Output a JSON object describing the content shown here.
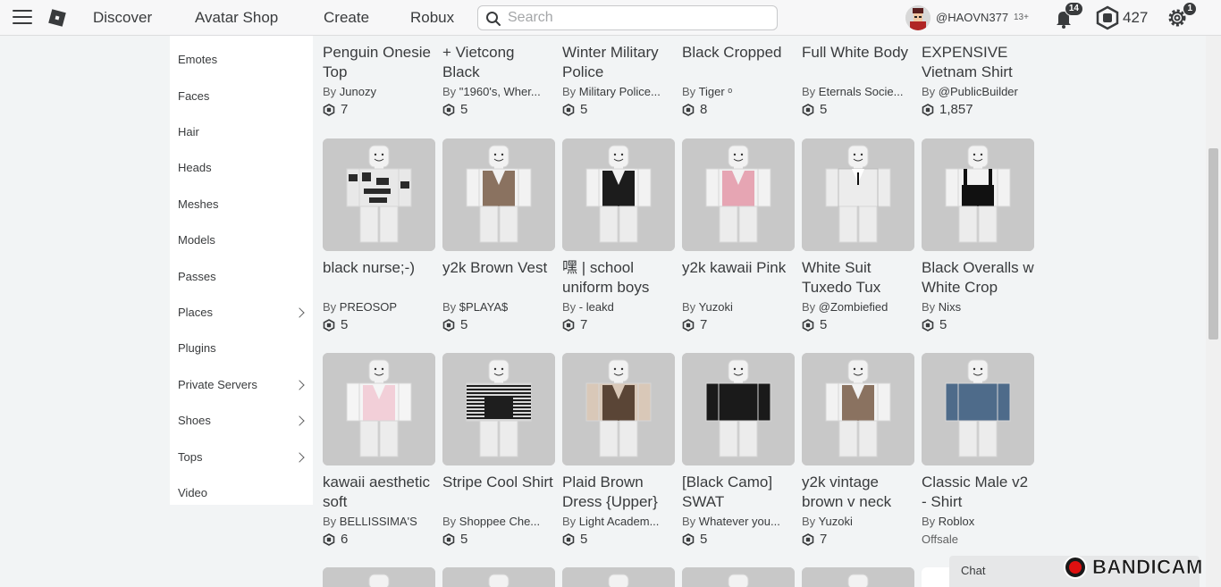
{
  "header": {
    "nav": [
      "Discover",
      "Avatar Shop",
      "Create",
      "Robux"
    ],
    "search_placeholder": "Search",
    "username": "@HAOVN377",
    "age": "13+",
    "notifications": "14",
    "robux": "427",
    "settings_badge": "1"
  },
  "sidebar": {
    "items": [
      {
        "label": "Emotes",
        "chevron": false
      },
      {
        "label": "Faces",
        "chevron": false
      },
      {
        "label": "Hair",
        "chevron": false
      },
      {
        "label": "Heads",
        "chevron": false
      },
      {
        "label": "Meshes",
        "chevron": false
      },
      {
        "label": "Models",
        "chevron": false
      },
      {
        "label": "Passes",
        "chevron": false
      },
      {
        "label": "Places",
        "chevron": true
      },
      {
        "label": "Plugins",
        "chevron": false
      },
      {
        "label": "Private Servers",
        "chevron": true
      },
      {
        "label": "Shoes",
        "chevron": true
      },
      {
        "label": "Tops",
        "chevron": true
      },
      {
        "label": "Video",
        "chevron": false
      }
    ]
  },
  "rows": [
    [
      {
        "name": "Penguin Onesie Top",
        "creator": "Junozy",
        "price": "7"
      },
      {
        "name": "+ Vietcong Black",
        "creator": "\"1960's, Wher...",
        "price": "5"
      },
      {
        "name": "Winter Military Police",
        "creator": "Military Police...",
        "price": "5"
      },
      {
        "name": "Black Cropped",
        "creator": "Tiger ᵒ",
        "price": "8"
      },
      {
        "name": "Full White Body",
        "creator": "Eternals Socie...",
        "price": "5"
      },
      {
        "name": "EXPENSIVE Vietnam Shirt",
        "creator": "@PublicBuilder",
        "price": "1,857"
      }
    ],
    [
      {
        "name": "black nurse;-)",
        "creator": "PREOSOP",
        "price": "5",
        "shirt": "pattern",
        "c1": "#2a2a2a",
        "c2": "#e8e8e8"
      },
      {
        "name": "y2k Brown Vest",
        "creator": "$PLAYA$",
        "price": "5",
        "shirt": "vest",
        "c1": "#8a7260",
        "c2": "#f2f2f2"
      },
      {
        "name": "嘿 | school uniform boys",
        "creator": "- leakd",
        "price": "7",
        "shirt": "vest",
        "c1": "#1c1c1c",
        "c2": "#f2f2f2"
      },
      {
        "name": "y2k kawaii Pink",
        "creator": "Yuzoki",
        "price": "7",
        "shirt": "vest",
        "c1": "#e6a5b3",
        "c2": "#f2f2f2"
      },
      {
        "name": "White Suit Tuxedo Tux",
        "creator": "@Zombiefied",
        "price": "5",
        "shirt": "suit",
        "c1": "#ececec",
        "c2": "#ececec"
      },
      {
        "name": "Black Overalls w White Crop",
        "creator": "Nixs",
        "price": "5",
        "shirt": "overall",
        "c1": "#111111",
        "c2": "#f2f2f2"
      }
    ],
    [
      {
        "name": "kawaii aesthetic soft",
        "creator": "BELLISSIMA'S",
        "price": "6",
        "shirt": "vest",
        "c1": "#f2cfd8",
        "c2": "#f5f5f5"
      },
      {
        "name": "Stripe Cool Shirt",
        "creator": "Shoppee Che...",
        "price": "5",
        "shirt": "stripe",
        "c1": "#1e1e1e",
        "c2": "#d8d8d8"
      },
      {
        "name": "Plaid Brown Dress {Upper}",
        "creator": "Light Academ...",
        "price": "5",
        "shirt": "vest",
        "c1": "#5a4536",
        "c2": "#d9c8b8"
      },
      {
        "name": "[Black Camo] SWAT",
        "creator": "Whatever you...",
        "price": "5",
        "shirt": "full",
        "c1": "#1a1a1a",
        "c2": "#2b2b2b"
      },
      {
        "name": "y2k vintage brown v neck",
        "creator": "Yuzoki",
        "price": "7",
        "shirt": "vest",
        "c1": "#8a7260",
        "c2": "#f2f2f2"
      },
      {
        "name": "Classic Male v2 - Shirt",
        "creator": "Roblox",
        "price": "",
        "offsale": "Offsale",
        "shirt": "full",
        "c1": "#4e6b8a",
        "c2": "#6f8aa6"
      }
    ]
  ],
  "by_label": "By",
  "chat_label": "Chat",
  "watermark": "BANDICAM"
}
